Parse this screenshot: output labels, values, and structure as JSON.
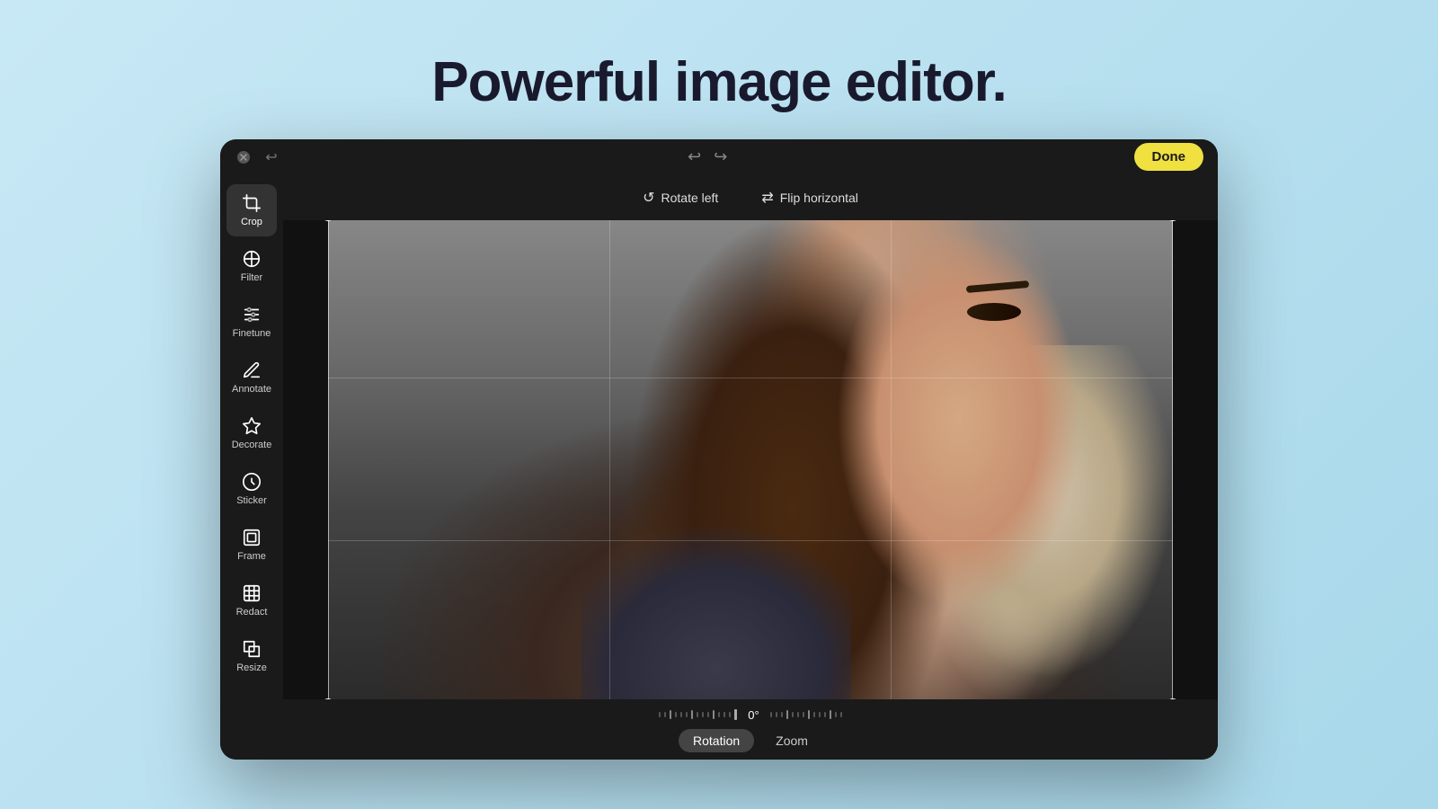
{
  "page": {
    "title": "Powerful image editor.",
    "background_color": "#b8ddef"
  },
  "window": {
    "close_label": "×",
    "undo_label": "↩",
    "redo_label": "↪",
    "done_button_label": "Done"
  },
  "toolbar": {
    "rotate_left_label": "Rotate left",
    "flip_horizontal_label": "Flip horizontal"
  },
  "sidebar": {
    "tools": [
      {
        "id": "crop",
        "label": "Crop",
        "active": true
      },
      {
        "id": "filter",
        "label": "Filter",
        "active": false
      },
      {
        "id": "finetune",
        "label": "Finetune",
        "active": false
      },
      {
        "id": "annotate",
        "label": "Annotate",
        "active": false
      },
      {
        "id": "decorate",
        "label": "Decorate",
        "active": false
      },
      {
        "id": "sticker",
        "label": "Sticker",
        "active": false
      },
      {
        "id": "frame",
        "label": "Frame",
        "active": false
      },
      {
        "id": "redact",
        "label": "Redact",
        "active": false
      },
      {
        "id": "resize",
        "label": "Resize",
        "active": false
      }
    ]
  },
  "bottom_bar": {
    "rotation_value": "0°",
    "mode_tabs": [
      {
        "label": "Rotation",
        "active": true
      },
      {
        "label": "Zoom",
        "active": false
      }
    ]
  }
}
